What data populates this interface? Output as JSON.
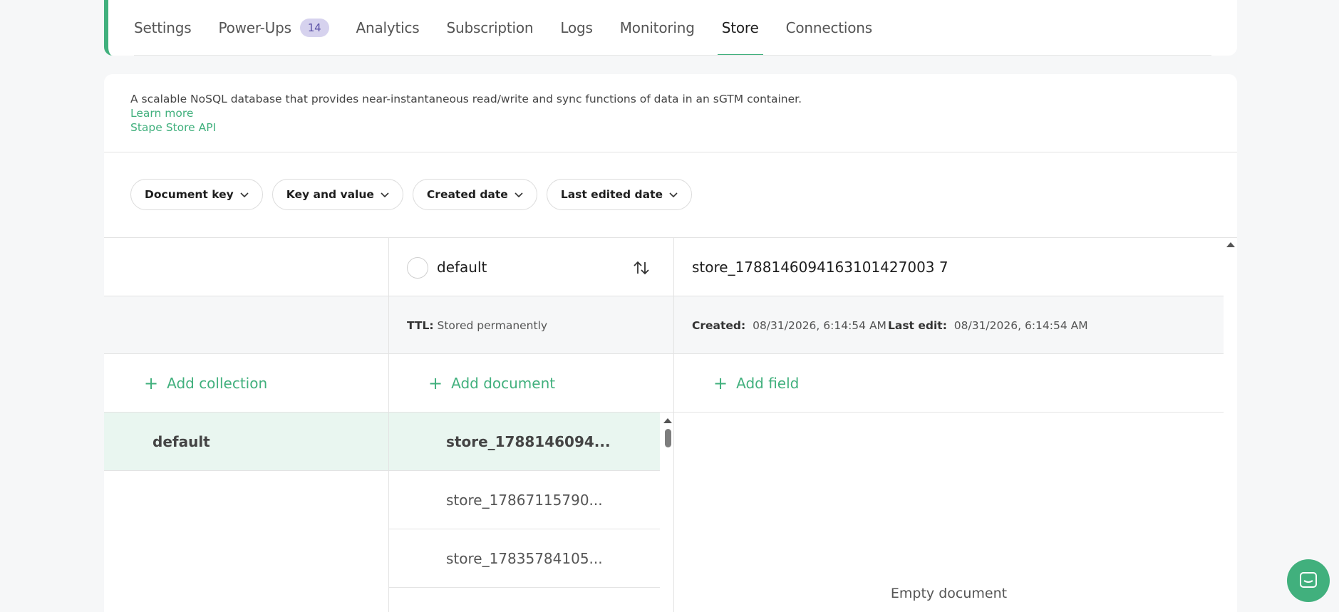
{
  "tabs": [
    {
      "label": "Settings"
    },
    {
      "label": "Power-Ups",
      "badge": "14"
    },
    {
      "label": "Analytics"
    },
    {
      "label": "Subscription"
    },
    {
      "label": "Logs"
    },
    {
      "label": "Monitoring"
    },
    {
      "label": "Store",
      "active": true
    },
    {
      "label": "Connections"
    }
  ],
  "description": {
    "text": "A scalable NoSQL database that provides near-instantaneous read/write and sync functions of data in an sGTM container.",
    "learn_more": "Learn more",
    "api_link": "Stape Store API"
  },
  "filters": [
    "Document key",
    "Key and value",
    "Created date",
    "Last edited date"
  ],
  "collections": {
    "add_label": "Add collection",
    "items": [
      "default"
    ]
  },
  "documents": {
    "header": "default",
    "ttl_label": "TTL:",
    "ttl_value": "Stored permanently",
    "add_label": "Add document",
    "items": [
      "store_1788146094...",
      "store_17867115790...",
      "store_17835784105..."
    ]
  },
  "document_view": {
    "title": "store_1788146094163101427003 7",
    "created_label": "Created:",
    "created_value": "08/31/2026, 6:14:54 AM",
    "edited_label": "Last edit:",
    "edited_value": "08/31/2026, 6:14:54 AM",
    "add_label": "Add field",
    "empty_text": "Empty document"
  },
  "colors": {
    "accent": "#41b07d",
    "badge_bg": "#d6d2ee",
    "selected_bg": "#e9f6f0"
  }
}
